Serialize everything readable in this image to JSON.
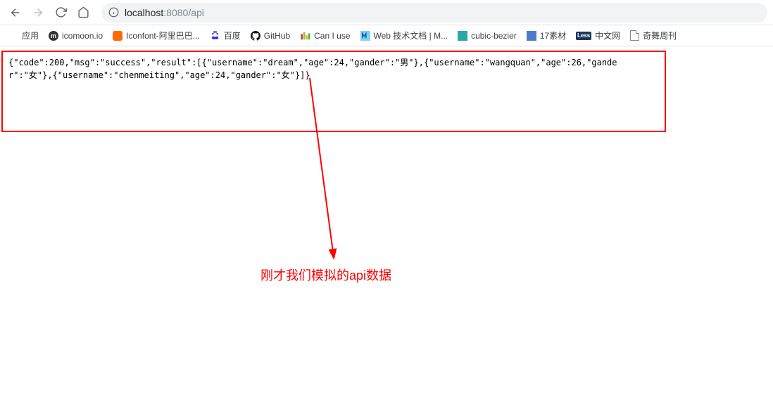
{
  "toolbar": {
    "url_host": "localhost",
    "url_port": ":8080",
    "url_path": "/api"
  },
  "bookmarks": {
    "apps": "应用",
    "icomoon": "icomoon.io",
    "iconfont": "Iconfont-阿里巴巴...",
    "baidu": "百度",
    "github": "GitHub",
    "caniuse": "Can I use",
    "webdoc": "Web 技术文档 | M...",
    "bezier": "cubic-bezier",
    "sucai17": "17素材",
    "less": "中文网",
    "less_badge": "Less",
    "qiwu": "奇舞周刊"
  },
  "json_response": "{\"code\":200,\"msg\":\"success\",\"result\":[{\"username\":\"dream\",\"age\":24,\"gander\":\"男\"},{\"username\":\"wangquan\",\"age\":26,\"gander\":\"女\"},{\"username\":\"chenmeiting\",\"age\":24,\"gander\":\"女\"}]}",
  "annotation": "刚才我们模拟的api数据"
}
